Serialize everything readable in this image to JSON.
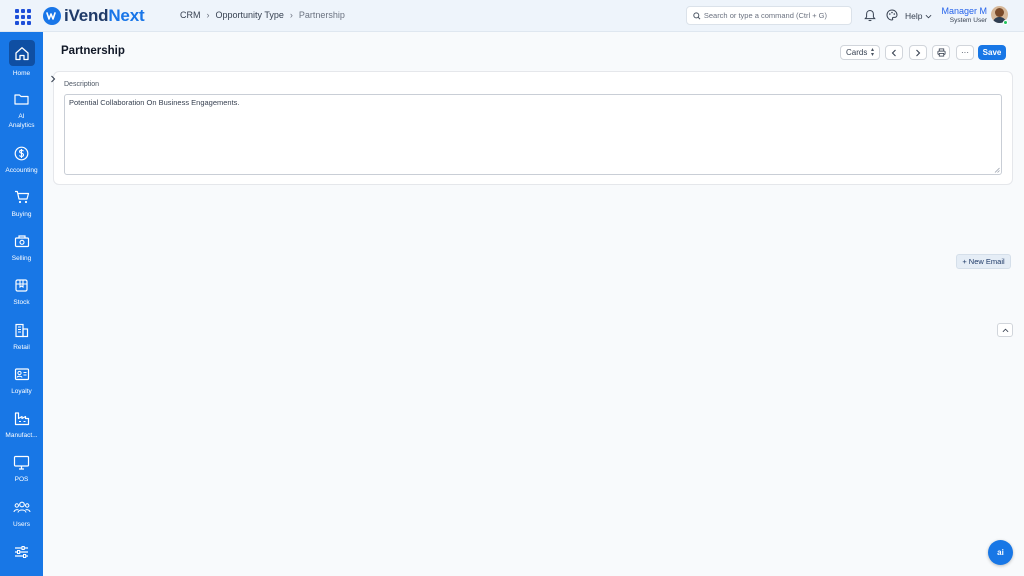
{
  "app": {
    "logo_mark": "iV",
    "logo_main": "iVend",
    "logo_accent": "Next"
  },
  "breadcrumb": {
    "items": [
      "CRM",
      "Opportunity Type"
    ],
    "current": "Partnership"
  },
  "search": {
    "placeholder": "Search or type a command (Ctrl + G)"
  },
  "header": {
    "help_label": "Help",
    "user_name": "Manager M",
    "user_role": "System User"
  },
  "sidebar": {
    "items": [
      {
        "label": "Home",
        "icon": "home-icon",
        "active": true
      },
      {
        "label": "AI\nAnalytics",
        "icon": "folder-icon"
      },
      {
        "label": "Accounting",
        "icon": "dollar-icon"
      },
      {
        "label": "Buying",
        "icon": "cart-icon"
      },
      {
        "label": "Selling",
        "icon": "selling-icon"
      },
      {
        "label": "Stock",
        "icon": "box-icon"
      },
      {
        "label": "Retail",
        "icon": "retail-icon"
      },
      {
        "label": "Loyalty",
        "icon": "loyalty-icon"
      },
      {
        "label": "Manufact...",
        "icon": "factory-icon"
      },
      {
        "label": "POS",
        "icon": "monitor-icon"
      },
      {
        "label": "Users",
        "icon": "users-icon"
      },
      {
        "label": "",
        "icon": "sliders-icon"
      }
    ]
  },
  "page": {
    "title": "Partnership",
    "view_select": "Cards",
    "save_label": "Save",
    "more_label": "···"
  },
  "form": {
    "description_label": "Description",
    "description_value": "Potential Collaboration On Business Engagements."
  },
  "actions": {
    "new_email_label": "+ New Email",
    "ai_label": "ai"
  },
  "colors": {
    "brand": "#1877e6",
    "sidebar": "#1877e6",
    "sidebar_active": "#0f4fa3"
  }
}
